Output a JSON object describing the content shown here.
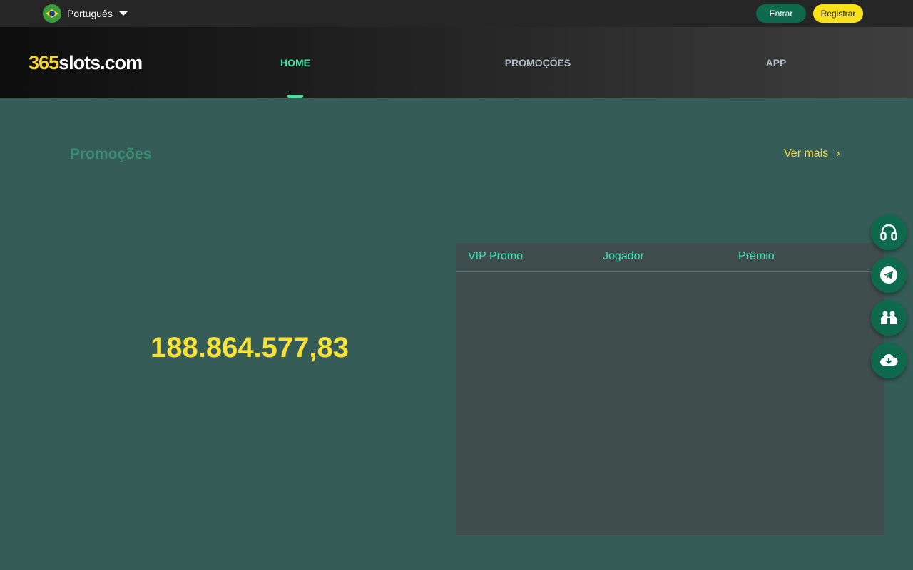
{
  "topbar": {
    "language": "Português",
    "login_label": "Entrar",
    "register_label": "Registrar"
  },
  "brand": {
    "logo_number": "365",
    "logo_text": "slots.com"
  },
  "nav": {
    "items": [
      {
        "label": "HOME",
        "active": true
      },
      {
        "label": "PROMOÇÕES",
        "active": false
      },
      {
        "label": "APP",
        "active": false
      }
    ]
  },
  "promo": {
    "title": "Promoções",
    "see_more": "Ver mais",
    "jackpot_value": "188.864.577,83"
  },
  "table": {
    "columns": [
      "VIP Promo",
      "Jogador",
      "Prêmio"
    ],
    "rows": []
  },
  "side_actions": [
    {
      "icon": "headset-icon"
    },
    {
      "icon": "telegram-icon"
    },
    {
      "icon": "community-icon"
    },
    {
      "icon": "download-cloud-icon"
    }
  ],
  "colors": {
    "background": "#355c57",
    "accent_green": "#3fe3a8",
    "accent_yellow": "#f9e238",
    "button_green": "#0f6a4d"
  }
}
